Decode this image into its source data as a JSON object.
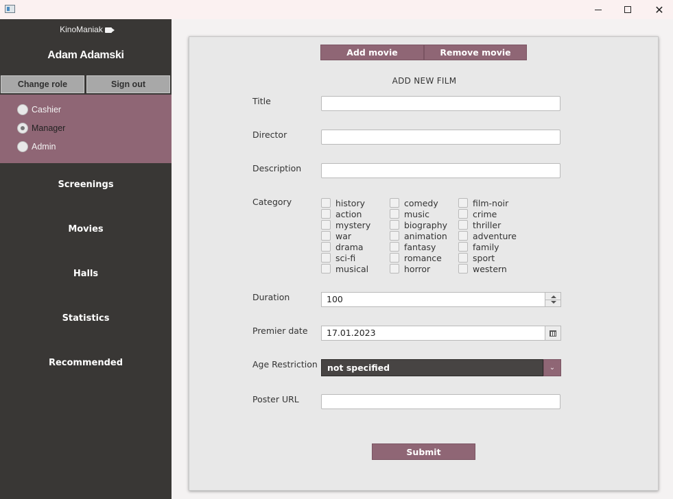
{
  "window": {
    "controls": {
      "minimize": "minimize",
      "maximize": "maximize",
      "close": "✕"
    }
  },
  "sidebar": {
    "brand": "KinoManiak",
    "user_name": "Adam Adamski",
    "change_role_label": "Change role",
    "sign_out_label": "Sign out",
    "roles": [
      {
        "label": "Cashier",
        "selected": false
      },
      {
        "label": "Manager",
        "selected": true
      },
      {
        "label": "Admin",
        "selected": false
      }
    ],
    "nav": [
      {
        "label": "Screenings"
      },
      {
        "label": "Movies"
      },
      {
        "label": "Halls"
      },
      {
        "label": "Statistics"
      },
      {
        "label": "Recommended"
      }
    ]
  },
  "main": {
    "tabs": [
      {
        "label": "Add movie"
      },
      {
        "label": "Remove movie"
      }
    ],
    "heading": "ADD NEW FILM",
    "fields": {
      "title_label": "Title",
      "title_value": "",
      "director_label": "Director",
      "director_value": "",
      "description_label": "Description",
      "description_value": "",
      "category_label": "Category",
      "duration_label": "Duration",
      "duration_value": "100",
      "premier_label": "Premier date",
      "premier_value": "17.01.2023",
      "age_label": "Age Restriction",
      "age_value": "not specified",
      "poster_label": "Poster URL",
      "poster_value": ""
    },
    "categories": [
      [
        "history",
        "action",
        "mystery",
        "war",
        "drama",
        "sci-fi",
        "musical"
      ],
      [
        "comedy",
        "music",
        "biography",
        "animation",
        "fantasy",
        "romance",
        "horror"
      ],
      [
        "film-noir",
        "crime",
        "thriller",
        "adventure",
        "family",
        "sport",
        "western"
      ]
    ],
    "submit_label": "Submit"
  },
  "colors": {
    "accent": "#8f6675",
    "sidebar_bg": "#393735",
    "panel_bg": "#e8e8e8",
    "combo_bg": "#474443"
  }
}
